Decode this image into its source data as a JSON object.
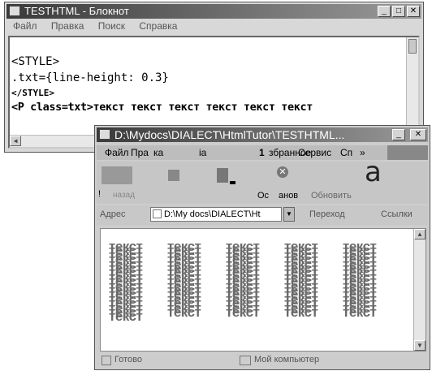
{
  "notepad": {
    "title": "TESTHTML - Блокнот",
    "menu": [
      "Файл",
      "Правка",
      "Поиск",
      "Справка"
    ],
    "lines": [
      "<STYLE>",
      ".txt={line-height: 0.3}",
      "</STYLE>",
      "<P class=txt>текст текст текст текст текст текст"
    ]
  },
  "browser": {
    "title": "D:\\Mydocs\\DIALECT\\HtmlTutor\\TESTHTML...",
    "menu": [
      "Файл",
      "Пра",
      "ка",
      "ia",
      "1",
      "збранное",
      "Сервис",
      "Сп",
      "»"
    ],
    "toolbar": {
      "back_label": "назад",
      "stop_label": "Ос",
      "refresh_label": "анов",
      "update_label": "Обновить",
      "big_glyph": "а"
    },
    "address_label": "Адрес",
    "address_value": "D:\\My docs\\DIALECT\\Ht",
    "go_label": "Переход",
    "links_label": "Ссылки",
    "word": "текст",
    "status_left": "Готово",
    "status_right": "Мой компьютер"
  }
}
